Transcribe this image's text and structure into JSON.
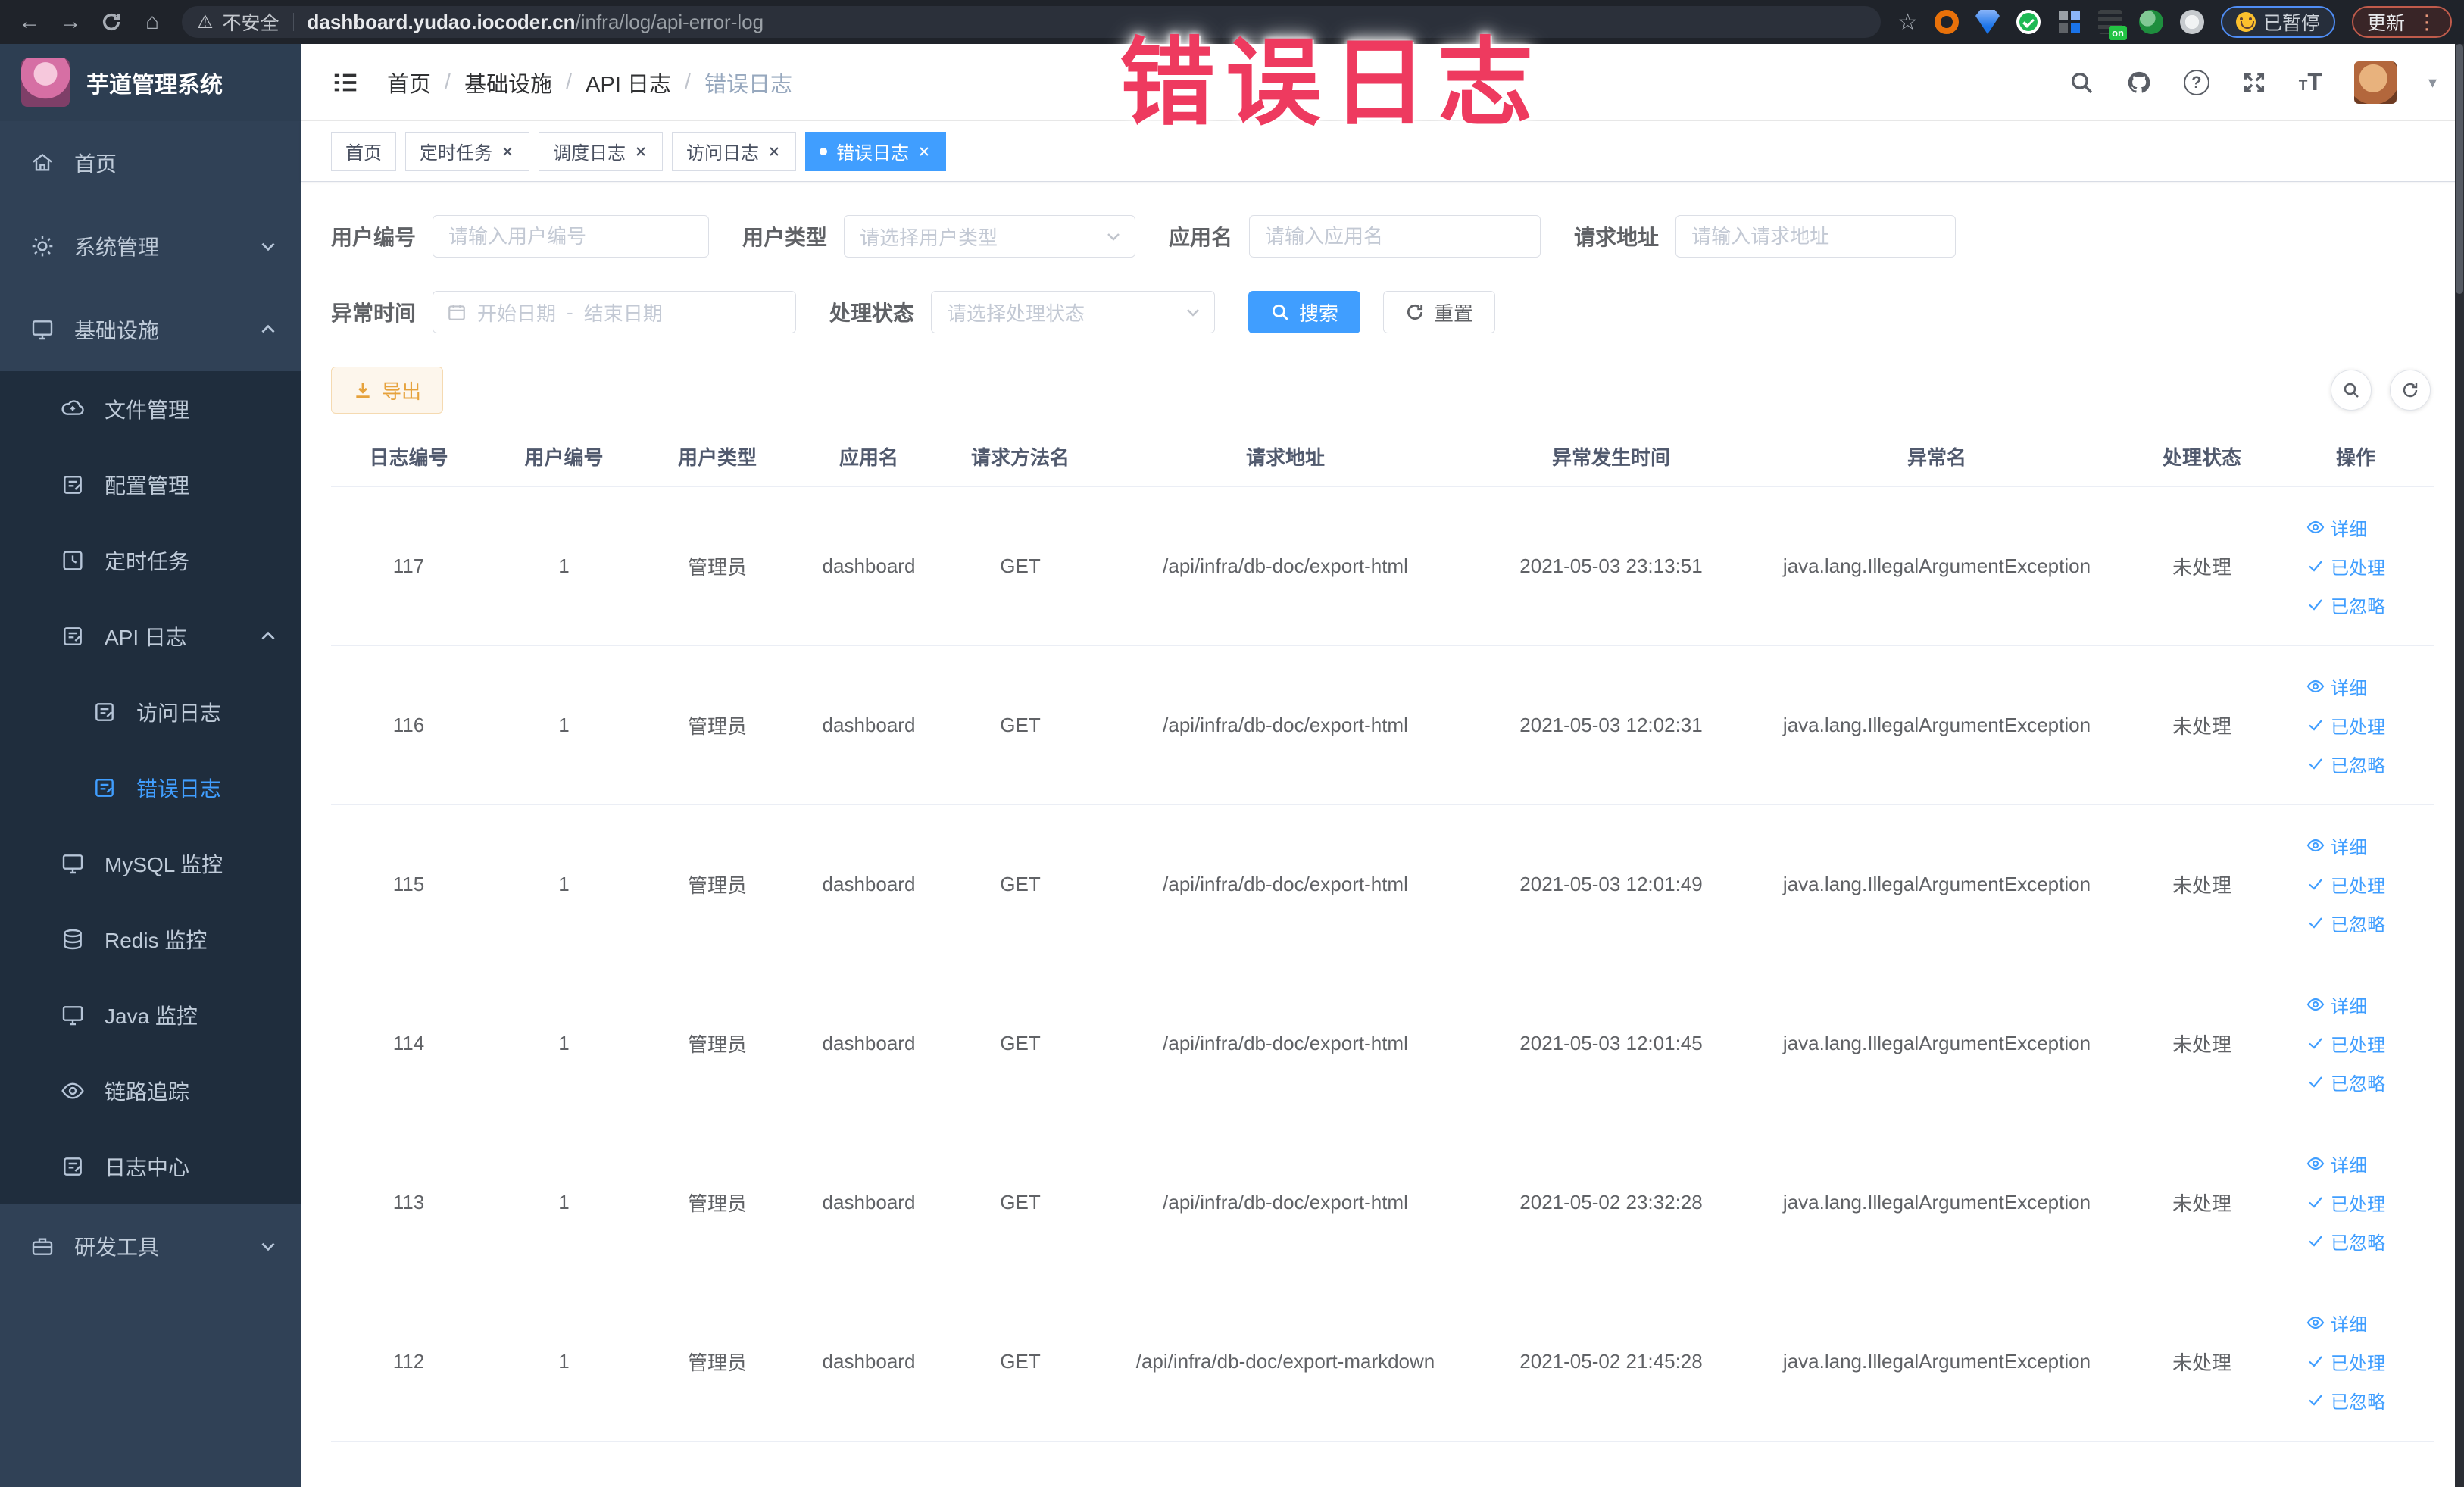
{
  "browser": {
    "security_label": "不安全",
    "url_host": "dashboard.yudao.iocoder.cn",
    "url_path": "/infra/log/api-error-log",
    "on_badge": "on",
    "paused_label": "已暂停",
    "update_label": "更新"
  },
  "icons": {
    "back": "←",
    "forward": "→",
    "home": "⌂",
    "star": "☆",
    "warning": "⚠",
    "kebab": "⋮",
    "help": "?",
    "caret_down": "▾",
    "font_size_big": "T",
    "font_size_small": "T"
  },
  "annotation": {
    "text": "错误日志",
    "color": "#ee3a5f"
  },
  "header": {
    "logo_title": "芋道管理系统",
    "breadcrumb": [
      "首页",
      "基础设施",
      "API 日志",
      "错误日志"
    ],
    "breadcrumb_separator": "/"
  },
  "tabs": [
    {
      "label": "首页",
      "closable": false,
      "active": false
    },
    {
      "label": "定时任务",
      "closable": true,
      "active": false
    },
    {
      "label": "调度日志",
      "closable": true,
      "active": false
    },
    {
      "label": "访问日志",
      "closable": true,
      "active": false
    },
    {
      "label": "错误日志",
      "closable": true,
      "active": true
    }
  ],
  "sidebar": {
    "items": [
      {
        "label": "首页",
        "level": 1
      },
      {
        "label": "系统管理",
        "level": 1,
        "chevron": "down"
      },
      {
        "label": "基础设施",
        "level": 1,
        "chevron": "up",
        "expanded": true
      },
      {
        "label": "文件管理",
        "level": 2
      },
      {
        "label": "配置管理",
        "level": 2
      },
      {
        "label": "定时任务",
        "level": 2
      },
      {
        "label": "API 日志",
        "level": 2,
        "chevron": "up",
        "expanded": true
      },
      {
        "label": "访问日志",
        "level": 3
      },
      {
        "label": "错误日志",
        "level": 3,
        "active": true
      },
      {
        "label": "MySQL 监控",
        "level": 2
      },
      {
        "label": "Redis 监控",
        "level": 2
      },
      {
        "label": "Java 监控",
        "level": 2
      },
      {
        "label": "链路追踪",
        "level": 2
      },
      {
        "label": "日志中心",
        "level": 2
      },
      {
        "label": "研发工具",
        "level": 1,
        "chevron": "down"
      }
    ]
  },
  "filters": {
    "user_id_label": "用户编号",
    "user_id_placeholder": "请输入用户编号",
    "user_type_label": "用户类型",
    "user_type_placeholder": "请选择用户类型",
    "app_name_label": "应用名",
    "app_name_placeholder": "请输入应用名",
    "request_url_label": "请求地址",
    "request_url_placeholder": "请输入请求地址",
    "time_label": "异常时间",
    "time_start_placeholder": "开始日期",
    "time_separator": "-",
    "time_end_placeholder": "结束日期",
    "status_label": "处理状态",
    "status_placeholder": "请选择处理状态",
    "search_label": "搜索",
    "reset_label": "重置"
  },
  "toolbar": {
    "export_label": "导出"
  },
  "table": {
    "columns": [
      "日志编号",
      "用户编号",
      "用户类型",
      "应用名",
      "请求方法名",
      "请求地址",
      "异常发生时间",
      "异常名",
      "处理状态",
      "操作"
    ],
    "actions": {
      "detail": "详细",
      "processed": "已处理",
      "ignored": "已忽略"
    },
    "rows": [
      {
        "id": "117",
        "user_id": "1",
        "user_type": "管理员",
        "app": "dashboard",
        "method": "GET",
        "url": "/api/infra/db-doc/export-html",
        "time": "2021-05-03 23:13:51",
        "exception": "java.lang.IllegalArgumentException",
        "status": "未处理"
      },
      {
        "id": "116",
        "user_id": "1",
        "user_type": "管理员",
        "app": "dashboard",
        "method": "GET",
        "url": "/api/infra/db-doc/export-html",
        "time": "2021-05-03 12:02:31",
        "exception": "java.lang.IllegalArgumentException",
        "status": "未处理"
      },
      {
        "id": "115",
        "user_id": "1",
        "user_type": "管理员",
        "app": "dashboard",
        "method": "GET",
        "url": "/api/infra/db-doc/export-html",
        "time": "2021-05-03 12:01:49",
        "exception": "java.lang.IllegalArgumentException",
        "status": "未处理"
      },
      {
        "id": "114",
        "user_id": "1",
        "user_type": "管理员",
        "app": "dashboard",
        "method": "GET",
        "url": "/api/infra/db-doc/export-html",
        "time": "2021-05-03 12:01:45",
        "exception": "java.lang.IllegalArgumentException",
        "status": "未处理"
      },
      {
        "id": "113",
        "user_id": "1",
        "user_type": "管理员",
        "app": "dashboard",
        "method": "GET",
        "url": "/api/infra/db-doc/export-html",
        "time": "2021-05-02 23:32:28",
        "exception": "java.lang.IllegalArgumentException",
        "status": "未处理"
      },
      {
        "id": "112",
        "user_id": "1",
        "user_type": "管理员",
        "app": "dashboard",
        "method": "GET",
        "url": "/api/infra/db-doc/export-markdown",
        "time": "2021-05-02 21:45:28",
        "exception": "java.lang.IllegalArgumentException",
        "status": "未处理"
      }
    ]
  },
  "colors": {
    "accent": "#409eff",
    "warning": "#e6a23c",
    "annotation": "#ee3a5f",
    "sidebar_bg": "#304156",
    "submenu_bg": "#1f2d3d"
  }
}
